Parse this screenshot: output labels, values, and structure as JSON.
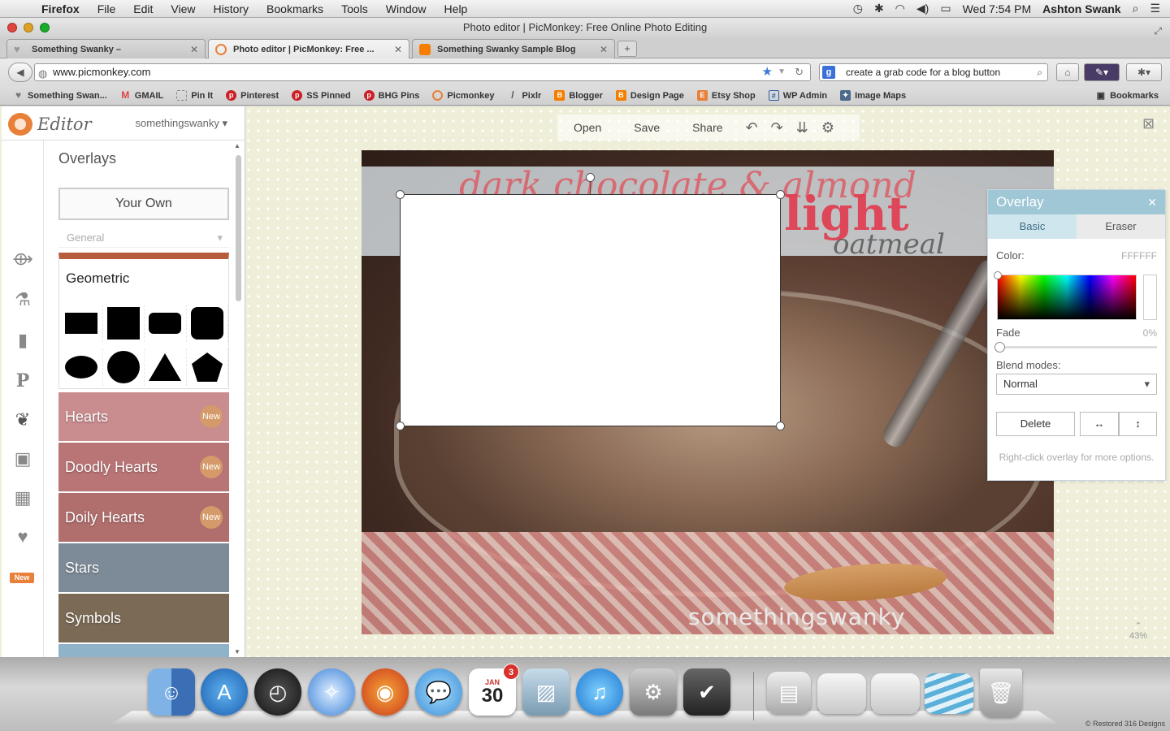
{
  "menubar": {
    "app_name": "Firefox",
    "items": [
      "File",
      "Edit",
      "View",
      "History",
      "Bookmarks",
      "Tools",
      "Window",
      "Help"
    ],
    "clock": "Wed 7:54 PM",
    "user": "Ashton Swank"
  },
  "window": {
    "title": "Photo editor | PicMonkey: Free Online Photo Editing"
  },
  "tabs": [
    {
      "label": "Something Swanky –",
      "active": false
    },
    {
      "label": "Photo editor | PicMonkey: Free ...",
      "active": true
    },
    {
      "label": "Something Swanky Sample Blog",
      "active": false
    }
  ],
  "nav": {
    "url": "www.picmonkey.com",
    "search_value": "create a grab code for a blog button"
  },
  "bookmarks": {
    "items": [
      "Something Swan...",
      "GMAIL",
      "Pin It",
      "Pinterest",
      "SS Pinned",
      "BHG Pins",
      "Picmonkey",
      "Pixlr",
      "Blogger",
      "Design Page",
      "Etsy Shop",
      "WP Admin",
      "Image Maps"
    ],
    "right_label": "Bookmarks"
  },
  "editor": {
    "logo_text": "Editor",
    "username": "somethingswanky",
    "panel_title": "Overlays",
    "your_own_label": "Your Own",
    "general_label": "General",
    "geometric_title": "Geometric",
    "new_rail_tag": "New",
    "categories": [
      {
        "label": "Hearts",
        "badge": "New",
        "color": "#c98c8f"
      },
      {
        "label": "Doodly Hearts",
        "badge": "New",
        "color": "#b97475"
      },
      {
        "label": "Doily Hearts",
        "badge": "New",
        "color": "#b06e6c"
      },
      {
        "label": "Stars",
        "badge": "",
        "color": "#7d8a97"
      },
      {
        "label": "Symbols",
        "badge": "",
        "color": "#7b6a55"
      }
    ]
  },
  "toolbar": {
    "open_label": "Open",
    "save_label": "Save",
    "share_label": "Share"
  },
  "photo": {
    "title_line1": "dark chocolate & almond",
    "title_line2": "light",
    "title_line3": "oatmeal",
    "watermark": "somethingswanky"
  },
  "overlay_panel": {
    "title": "Overlay",
    "tab_basic": "Basic",
    "tab_eraser": "Eraser",
    "color_label": "Color:",
    "color_value": "FFFFFF",
    "fade_label": "Fade",
    "fade_value": "0%",
    "fade_level": 0,
    "blend_label": "Blend modes:",
    "blend_value": "Normal",
    "delete_label": "Delete",
    "hint": "Right-click overlay for more options."
  },
  "zoom_level": "43%",
  "dock": {
    "calendar_month": "JAN",
    "calendar_day": "30",
    "calendar_badge": "3",
    "copyright": "© Restored 316 Designs"
  }
}
